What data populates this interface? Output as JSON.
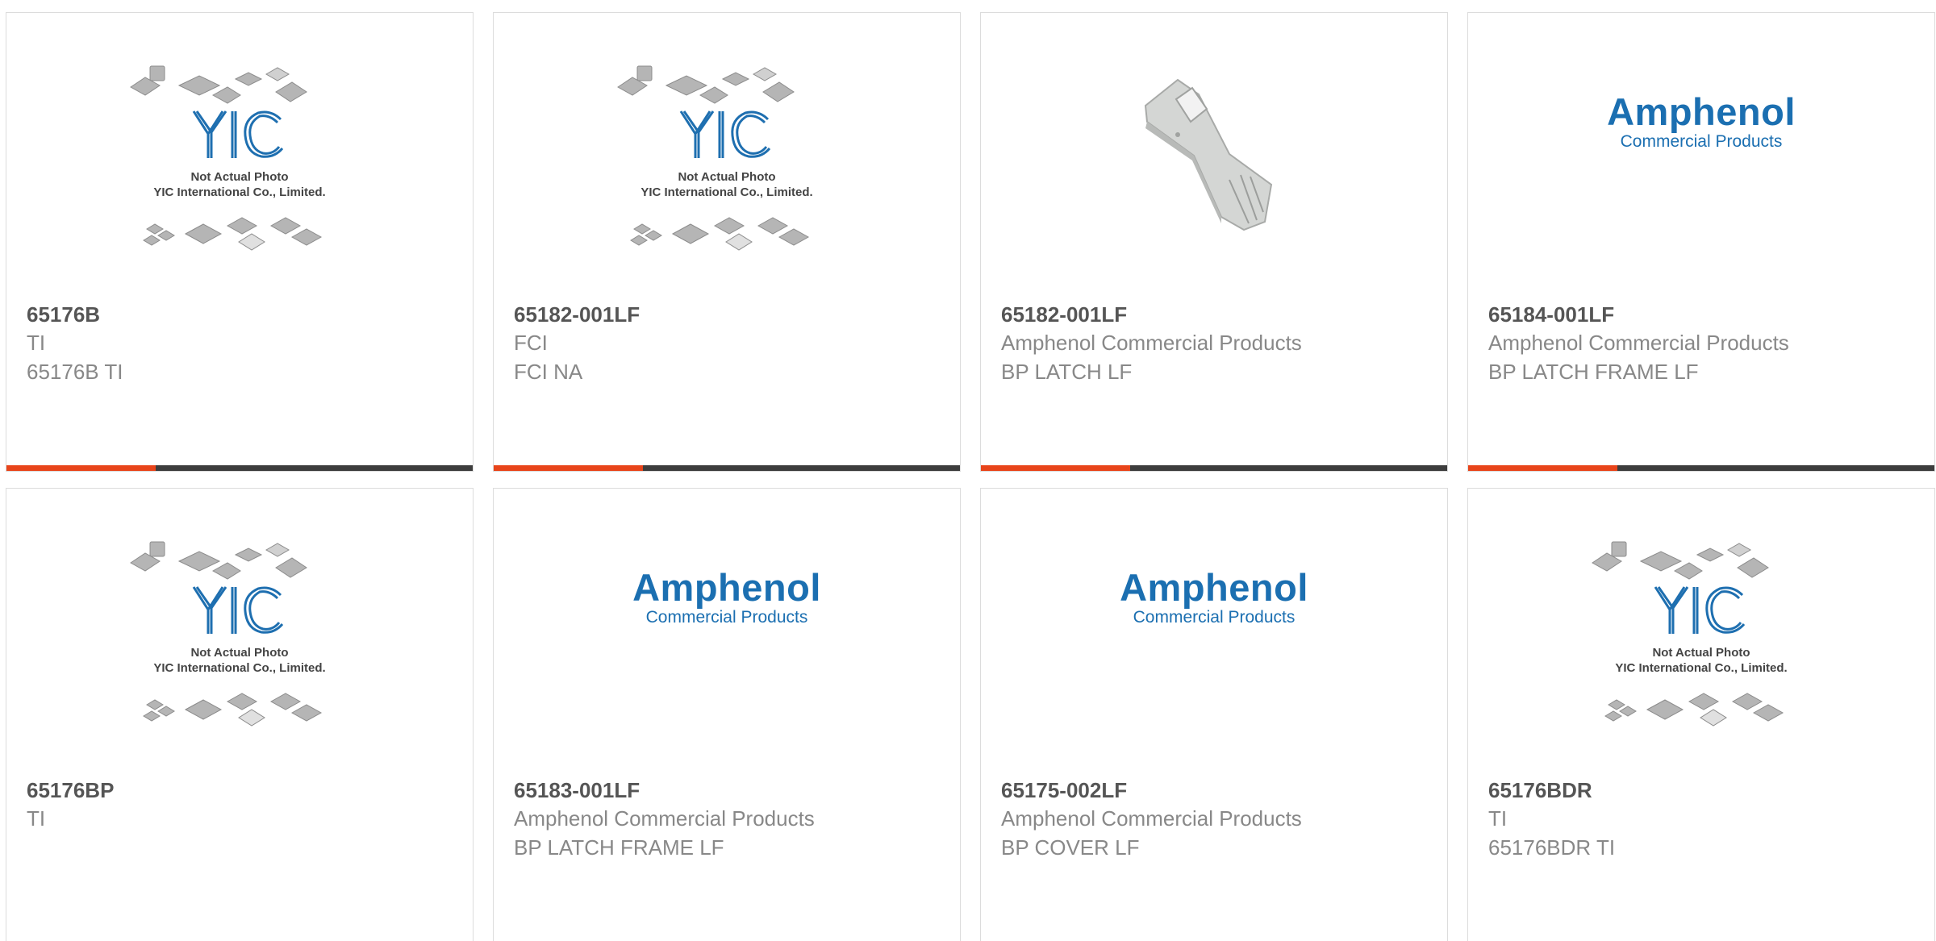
{
  "brand": {
    "accent": "#e8441a",
    "bar": "#3d3d3d",
    "amphenol_blue": "#1b6fb1",
    "yic_blue": "#1e6fb0"
  },
  "placeholder": {
    "logo": "YIC",
    "line1": "Not Actual Photo",
    "line2": "YIC International Co., Limited."
  },
  "amphenol_logo": {
    "name": "Amphenol",
    "sub": "Commercial Products"
  },
  "bar_fill": 0.32,
  "cards": [
    {
      "part": "65176B",
      "mfr": "TI",
      "desc": "65176B TI",
      "image": "yic-placeholder"
    },
    {
      "part": "65182-001LF",
      "mfr": "FCI",
      "desc": "FCI NA",
      "image": "yic-placeholder"
    },
    {
      "part": "65182-001LF",
      "mfr": "Amphenol Commercial Products",
      "desc": "BP LATCH LF",
      "image": "latch-photo"
    },
    {
      "part": "65184-001LF",
      "mfr": "Amphenol Commercial Products",
      "desc": "BP LATCH FRAME LF",
      "image": "amphenol-logo"
    },
    {
      "part": "65176BP",
      "mfr": "TI",
      "desc": "",
      "image": "yic-placeholder"
    },
    {
      "part": "65183-001LF",
      "mfr": "Amphenol Commercial Products",
      "desc": "BP LATCH FRAME LF",
      "image": "amphenol-logo"
    },
    {
      "part": "65175-002LF",
      "mfr": "Amphenol Commercial Products",
      "desc": "BP COVER LF",
      "image": "amphenol-logo"
    },
    {
      "part": "65176BDR",
      "mfr": "TI",
      "desc": "65176BDR TI",
      "image": "yic-placeholder"
    }
  ]
}
